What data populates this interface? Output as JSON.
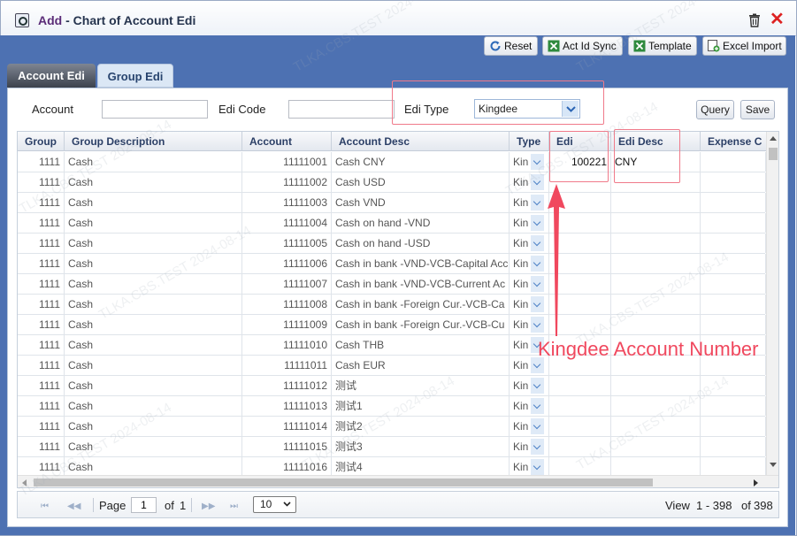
{
  "window": {
    "title_prefix": "Add",
    "title_sep": " - ",
    "title": "Chart of Account Edi"
  },
  "toolbar": {
    "reset": "Reset",
    "act_id_sync": "Act Id Sync",
    "template": "Template",
    "excel_import": "Excel Import"
  },
  "tabs": [
    {
      "label": "Account Edi"
    },
    {
      "label": "Group Edi"
    }
  ],
  "filters": {
    "account_label": "Account",
    "account_value": "",
    "edi_code_label": "Edi Code",
    "edi_code_value": "",
    "edi_type_label": "Edi Type",
    "edi_type_value": "Kingdee",
    "query": "Query",
    "save": "Save"
  },
  "grid": {
    "headers": [
      "Group",
      "Group Description",
      "Account",
      "Account Desc",
      "Type",
      "Edi",
      "Edi Desc",
      "Expense C"
    ],
    "rows": [
      {
        "group": "1111",
        "group_desc": "Cash",
        "account": "11111001",
        "account_desc": "Cash CNY",
        "type": "Kin",
        "edi": "100221",
        "edi_desc": "CNY"
      },
      {
        "group": "1111",
        "group_desc": "Cash",
        "account": "11111002",
        "account_desc": "Cash USD",
        "type": "Kin",
        "edi": "",
        "edi_desc": ""
      },
      {
        "group": "1111",
        "group_desc": "Cash",
        "account": "11111003",
        "account_desc": "Cash VND",
        "type": "Kin",
        "edi": "",
        "edi_desc": ""
      },
      {
        "group": "1111",
        "group_desc": "Cash",
        "account": "11111004",
        "account_desc": "Cash on hand -VND",
        "type": "Kin",
        "edi": "",
        "edi_desc": ""
      },
      {
        "group": "1111",
        "group_desc": "Cash",
        "account": "11111005",
        "account_desc": "Cash on hand -USD",
        "type": "Kin",
        "edi": "",
        "edi_desc": ""
      },
      {
        "group": "1111",
        "group_desc": "Cash",
        "account": "11111006",
        "account_desc": "Cash in bank -VND-VCB-Capital Acc",
        "type": "Kin",
        "edi": "",
        "edi_desc": ""
      },
      {
        "group": "1111",
        "group_desc": "Cash",
        "account": "11111007",
        "account_desc": "Cash in bank -VND-VCB-Current Ac",
        "type": "Kin",
        "edi": "",
        "edi_desc": ""
      },
      {
        "group": "1111",
        "group_desc": "Cash",
        "account": "11111008",
        "account_desc": "Cash in bank -Foreign Cur.-VCB-Ca",
        "type": "Kin",
        "edi": "",
        "edi_desc": ""
      },
      {
        "group": "1111",
        "group_desc": "Cash",
        "account": "11111009",
        "account_desc": "Cash in bank -Foreign Cur.-VCB-Cu",
        "type": "Kin",
        "edi": "",
        "edi_desc": ""
      },
      {
        "group": "1111",
        "group_desc": "Cash",
        "account": "11111010",
        "account_desc": "Cash THB",
        "type": "Kin",
        "edi": "",
        "edi_desc": ""
      },
      {
        "group": "1111",
        "group_desc": "Cash",
        "account": "11111011",
        "account_desc": "Cash EUR",
        "type": "Kin",
        "edi": "",
        "edi_desc": ""
      },
      {
        "group": "1111",
        "group_desc": "Cash",
        "account": "11111012",
        "account_desc": "测试",
        "type": "Kin",
        "edi": "",
        "edi_desc": ""
      },
      {
        "group": "1111",
        "group_desc": "Cash",
        "account": "11111013",
        "account_desc": "测试1",
        "type": "Kin",
        "edi": "",
        "edi_desc": ""
      },
      {
        "group": "1111",
        "group_desc": "Cash",
        "account": "11111014",
        "account_desc": "测试2",
        "type": "Kin",
        "edi": "",
        "edi_desc": ""
      },
      {
        "group": "1111",
        "group_desc": "Cash",
        "account": "11111015",
        "account_desc": "测试3",
        "type": "Kin",
        "edi": "",
        "edi_desc": ""
      },
      {
        "group": "1111",
        "group_desc": "Cash",
        "account": "11111016",
        "account_desc": "测试4",
        "type": "Kin",
        "edi": "",
        "edi_desc": ""
      }
    ]
  },
  "pager": {
    "page_label": "Page",
    "page_value": "1",
    "of_label": "of",
    "total_pages": "1",
    "page_size": "10",
    "view_label": "View",
    "range": "1 - 398",
    "of_total_label": "of",
    "total_records": "398"
  },
  "annotation": {
    "text": "Kingdee Account Number",
    "color": "#f0485e"
  },
  "watermark": "TLKA.CBS.TEST 2024-08-14",
  "colors": {
    "frame_blue": "#4d71b2",
    "close_red": "#d22222",
    "header_text": "#2b3f66"
  }
}
